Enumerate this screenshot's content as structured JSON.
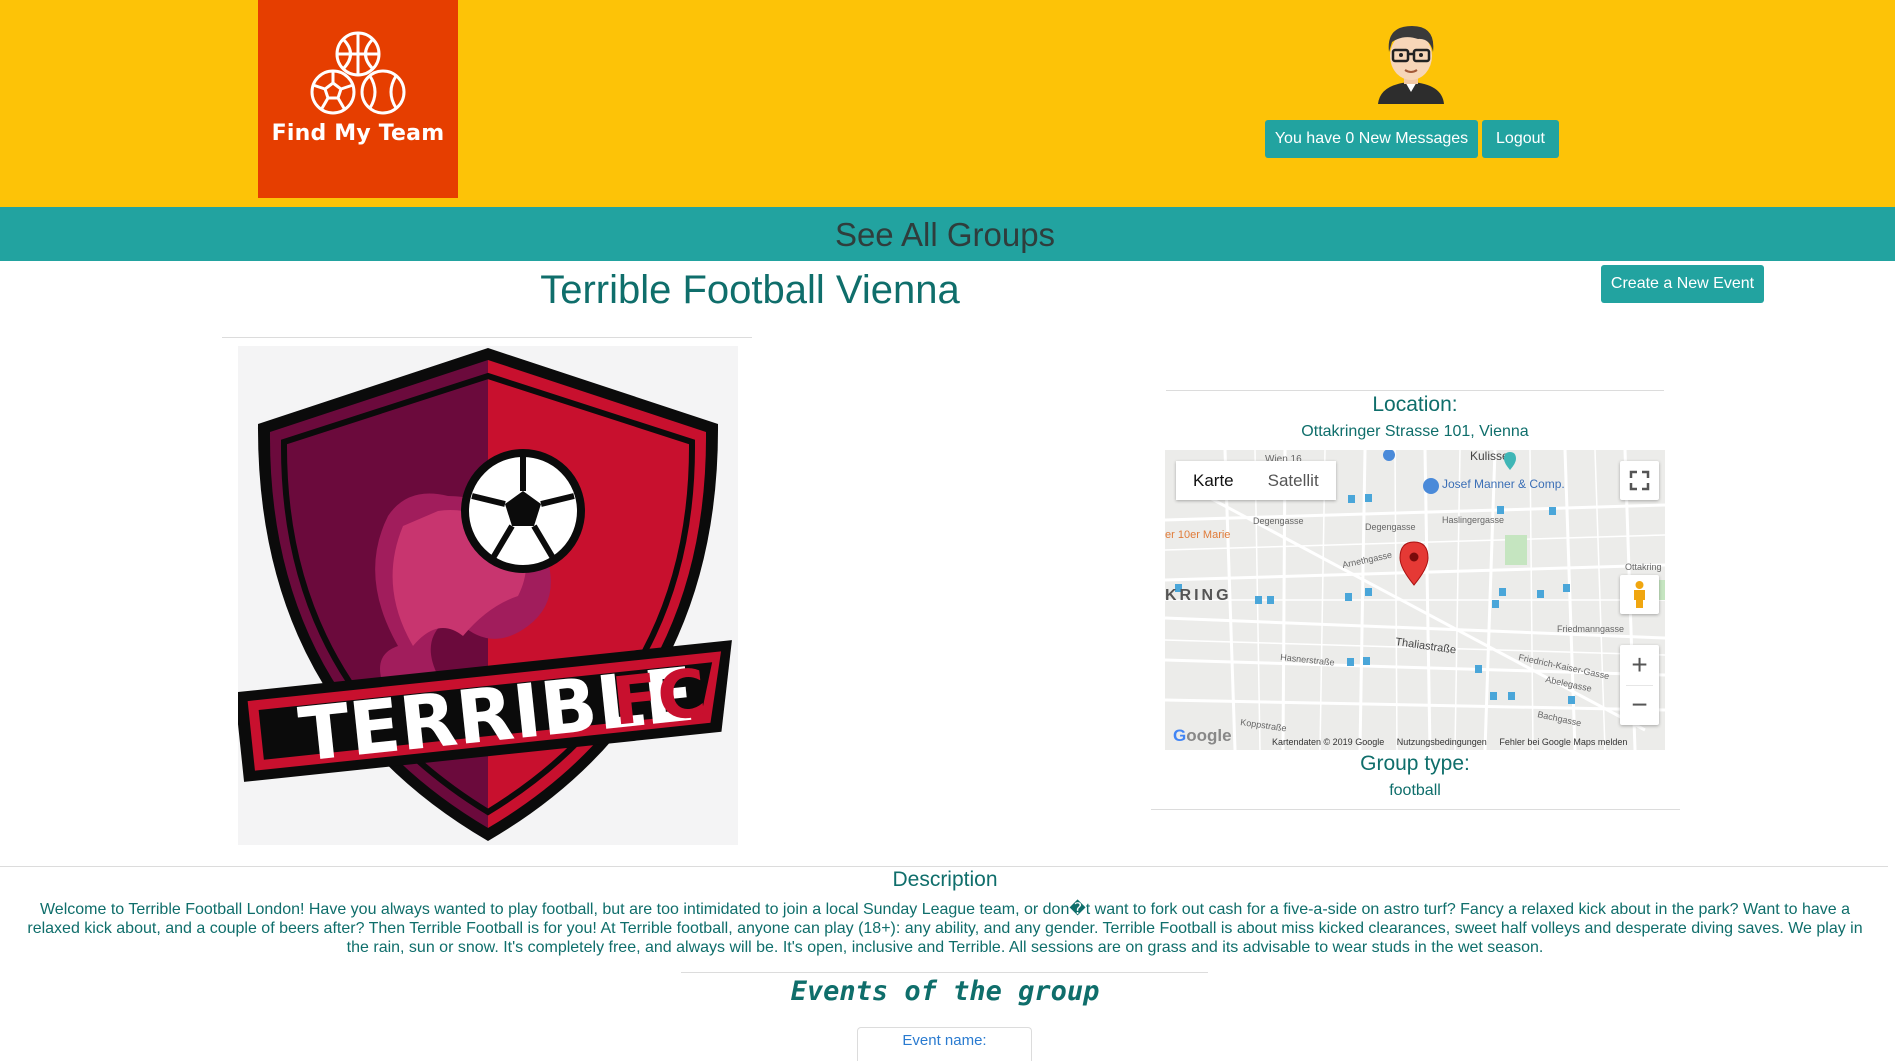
{
  "header": {
    "logo_text": "Find My Team",
    "messages_button": "You have 0 New Messages",
    "logout_button": "Logout"
  },
  "nav": {
    "all_groups": "See All Groups"
  },
  "group": {
    "title": "Terrible Football Vienna",
    "create_event_button": "Create a New Event",
    "crest_text_main": "TERRIBLE",
    "crest_text_fc": "FC",
    "location_label": "Location:",
    "location_value": "Ottakringer Strasse 101, Vienna",
    "group_type_label": "Group type:",
    "group_type_value": "football",
    "description_label": "Description",
    "description_text": "Welcome to Terrible Football London! Have you always wanted to play football, but are too intimidated to join a local Sunday League team, or don�t want to fork out cash for a five-a-side on astro turf? Fancy a relaxed kick about in the park? Want to have a relaxed kick about, and a couple of beers after? Then Terrible Football is for you! At Terrible football, anyone can play (18+): any ability, and any gender. Terrible Football is about miss kicked clearances, sweet half volleys and desperate diving saves. We play in the rain, sun or snow. It's completely free, and always will be. It's open, inclusive and Terrible. All sessions are on grass and its advisable to wear studs in the wet season.",
    "events_title": "Events of the group",
    "event_name_label": "Event name:"
  },
  "map": {
    "tab_map": "Karte",
    "tab_satellite": "Satellit",
    "zoom_in": "+",
    "zoom_out": "−",
    "google_logo": "Google",
    "footer_data": "Kartendaten © 2019 Google",
    "footer_terms": "Nutzungsbedingungen",
    "footer_report": "Fehler bei Google Maps melden",
    "streets": [
      "Kulisse",
      "Josef Manner & Comp.",
      "Degengasse",
      "Haslingergasse",
      "er 10er Marie",
      "KRING",
      "Thaliastraße",
      "Hasnerstraße",
      "Friedmanngasse",
      "Friedrich-Kaiser-Gasse",
      "Abelegasse",
      "Bachgasse",
      "Koppstraße",
      "Arnethgasse",
      "Wien 16",
      "Ottakring"
    ]
  },
  "colors": {
    "header_bg": "#fdc307",
    "logo_bg": "#e63e00",
    "accent": "#22a3a0",
    "text_teal": "#0f6e6b"
  }
}
